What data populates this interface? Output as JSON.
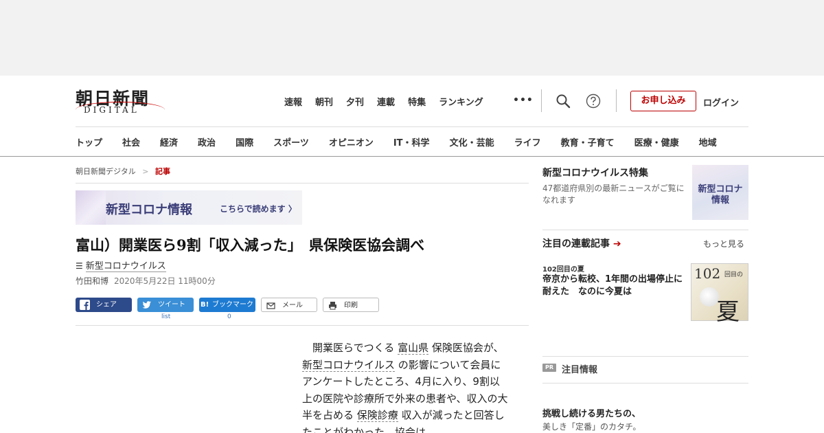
{
  "header": {
    "logo_jp": "朝日新聞",
    "logo_en": "DIGITAL",
    "top_nav": [
      "速報",
      "朝刊",
      "夕刊",
      "連載",
      "特集",
      "ランキング"
    ],
    "more_dots": "•••",
    "subscribe": "お申し込み",
    "login": "ログイン",
    "categories": [
      "トップ",
      "社会",
      "経済",
      "政治",
      "国際",
      "スポーツ",
      "オピニオン",
      "IT・科学",
      "文化・芸能",
      "ライフ",
      "教育・子育て",
      "医療・健康",
      "地域"
    ]
  },
  "breadcrumb": {
    "home": "朝日新聞デジタル",
    "sep": ">",
    "current": "記事"
  },
  "banner": {
    "title": "新型コロナ情報",
    "cta": "こちらで読めます"
  },
  "article": {
    "headline": "富山）開業医ら9割「収入減った」　県保険医協会調べ",
    "topic": "新型コロナウイルス",
    "author": "竹田和博",
    "date": "2020年5月22日 11時00分",
    "share": {
      "facebook": "シェア",
      "twitter": "ツイート",
      "hatena": "ブックマーク",
      "hatena_logo": "B!",
      "mail": "メール",
      "print": "印刷",
      "twitter_count": "list",
      "hatena_count": "0"
    },
    "body": {
      "p1": "開業医らでつくる",
      "k1": "富山県",
      "p2": "保険医協会が、",
      "k2": "新型コロナウイルス",
      "p3": "の影響について会員にアンケートしたところ、4月に入り、9割以上の医院や診療所で外来の患者や、収入の大半を占める",
      "k3": "保険診療",
      "p4": "収入が減ったと回答したことがわかった。協会は"
    }
  },
  "sidebar": {
    "feature_title": "新型コロナウイルス特集",
    "feature_desc": "47都道府県別の最新ニュースがご覧になれます",
    "feature_thumb_line1": "新型コロナ",
    "feature_thumb_line2": "情報",
    "series_heading": "注目の連載記事",
    "series_more": "もっと見る",
    "series_tag": "102回目の夏",
    "series_title": "帝京から転校、1年間の出場停止に耐えた　なのに今夏は",
    "series_thumb_num": "102",
    "series_thumb_small": "回目の",
    "series_thumb_kanji": "夏",
    "pr_badge": "PR",
    "pr_label": "注目情報",
    "pr_title": "挑戦し続ける男たちの、",
    "pr_sub": "美しき「定番」のカタチ。"
  },
  "colors": {
    "accent_red": "#b00000",
    "facebook": "#2d4a8a",
    "twitter": "#3a8fd6",
    "hatena": "#1e7bd2"
  }
}
